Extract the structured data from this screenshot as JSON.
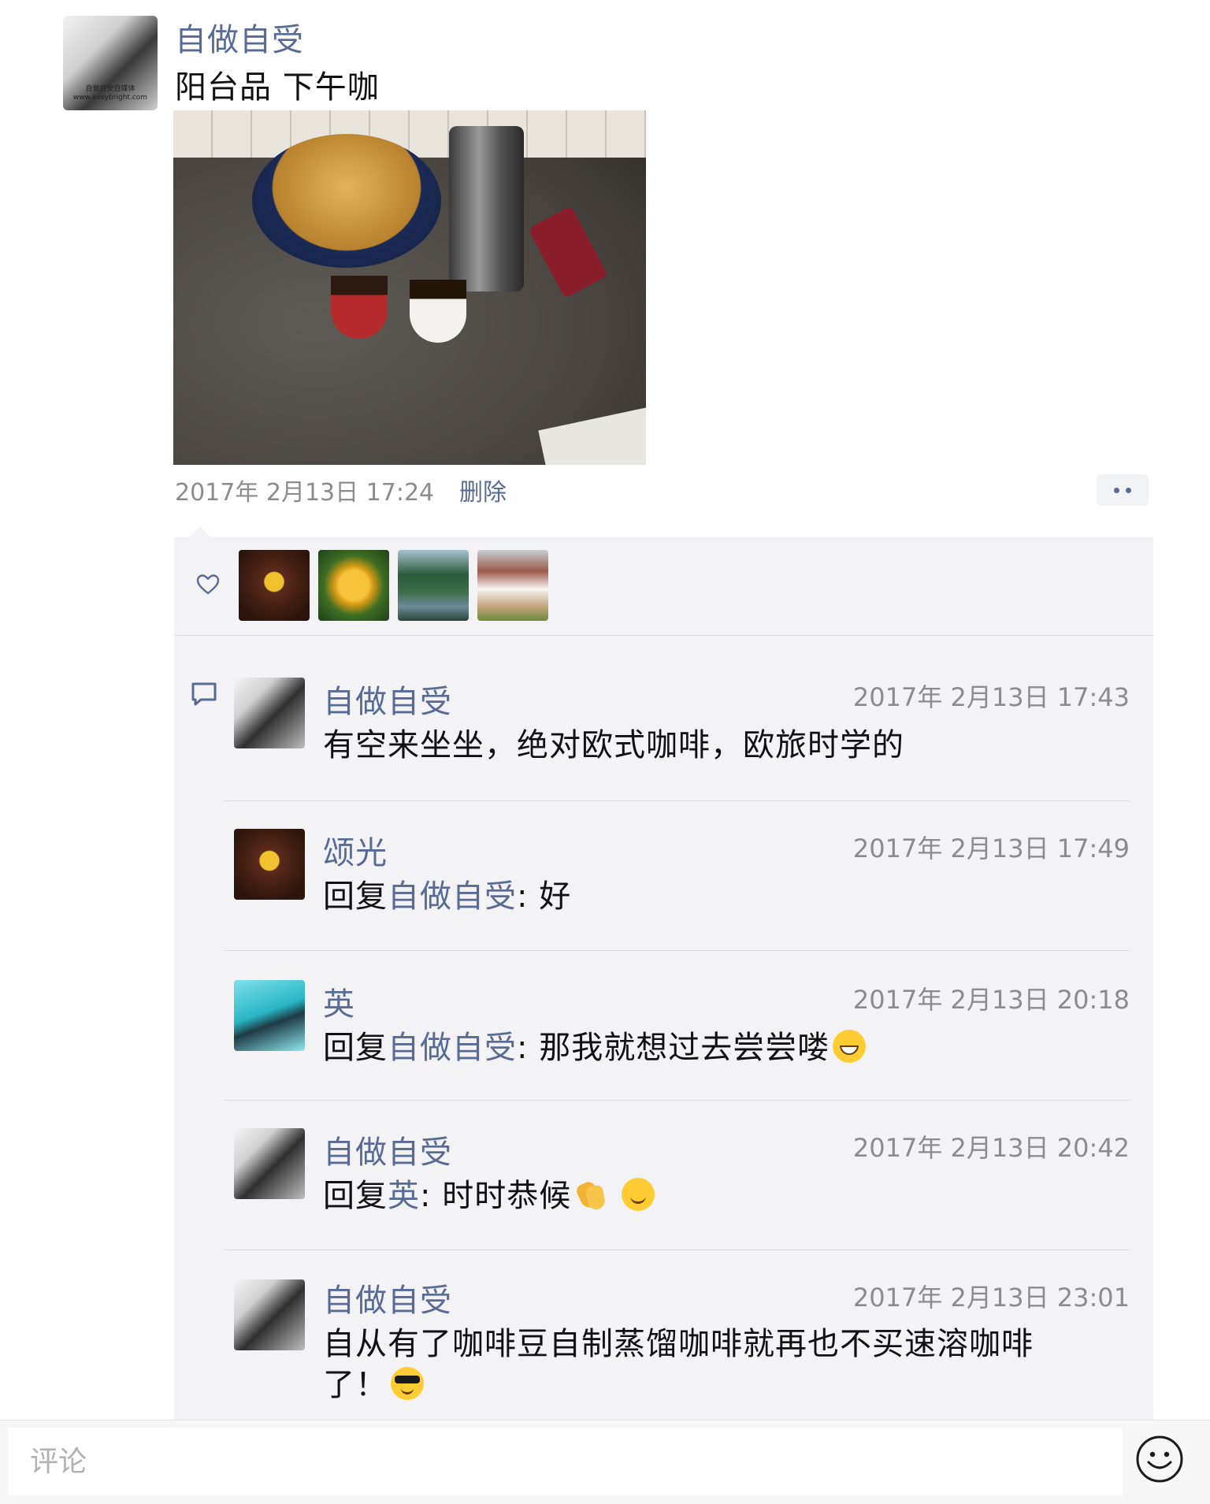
{
  "post": {
    "author": "自做自受",
    "text": "阳台品 下午咖",
    "avatar_caption_line1": "自做自受自媒体",
    "avatar_caption_line2": "www.easybright.com",
    "time": "2017年 2月13日 17:24",
    "delete_label": "删除",
    "more_icon": "more-dots-icon"
  },
  "likes": {
    "icon": "heart-icon"
  },
  "comments_icon": "comment-bubble-icon",
  "comments": [
    {
      "name": "自做自受",
      "time": "2017年 2月13日 17:43",
      "text": "有空来坐坐，绝对欧式咖啡，欧旅时学的"
    },
    {
      "name": "颂光",
      "time": "2017年 2月13日 17:49",
      "reply_prefix": "回复",
      "reply_to": "自做自受",
      "text": ": 好"
    },
    {
      "name": "英",
      "time": "2017年 2月13日 20:18",
      "reply_prefix": "回复",
      "reply_to": "自做自受",
      "text": ": 那我就想过去尝尝喽",
      "emoji": "grinning-face-emoji"
    },
    {
      "name": "自做自受",
      "time": "2017年 2月13日 20:42",
      "reply_prefix": "回复",
      "reply_to": "英",
      "text": ": 时时恭候",
      "emoji": "clapping-hands-emoji",
      "emoji2": "smiling-face-emoji"
    },
    {
      "name": "自做自受",
      "time": "2017年 2月13日 23:01",
      "text_line1": "自从有了咖啡豆自制蒸馏咖啡就再也不买速溶咖啡",
      "text_line2": "了！",
      "emoji": "sunglasses-face-emoji"
    }
  ],
  "input": {
    "placeholder": "评论",
    "value": ""
  },
  "colors": {
    "link": "#576b95",
    "meta": "#8c8c8c",
    "panel": "#f3f3f5"
  }
}
